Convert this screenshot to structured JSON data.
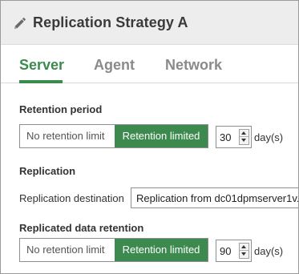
{
  "header": {
    "title": "Replication Strategy A",
    "edit_icon": "pencil-icon"
  },
  "tabs": [
    {
      "label": "Server",
      "active": true
    },
    {
      "label": "Agent",
      "active": false
    },
    {
      "label": "Network",
      "active": false
    }
  ],
  "retention_period": {
    "label": "Retention period",
    "options": [
      "No retention limit",
      "Retention limited"
    ],
    "selected": "Retention limited",
    "value": "30",
    "unit": "day(s)"
  },
  "replication": {
    "label": "Replication",
    "destination_label": "Replication destination",
    "destination_value": "Replication from dc01dpmserver1v."
  },
  "replicated_data_retention": {
    "label": "Replicated data retention",
    "options": [
      "No retention limit",
      "Retention limited"
    ],
    "selected": "Retention limited",
    "value": "90",
    "unit": "day(s)"
  },
  "colors": {
    "accent": "#3c8a4e",
    "header_bg": "#ededed",
    "inactive_tab": "#8a8a8a"
  }
}
